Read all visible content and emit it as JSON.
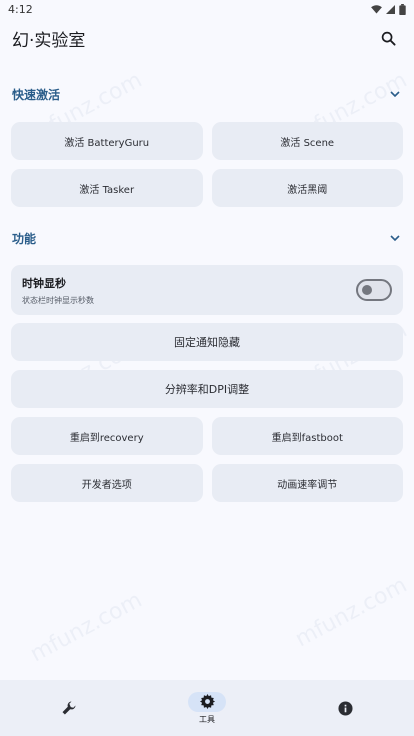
{
  "status_bar": {
    "time": "4:12"
  },
  "app_bar": {
    "title": "幻·实验室"
  },
  "quick_activate": {
    "title": "快速激活",
    "buttons": [
      "激活 BatteryGuru",
      "激活 Scene",
      "激活 Tasker",
      "激活黑阈"
    ]
  },
  "features": {
    "title": "功能",
    "clock_toggle": {
      "title": "时钟显秒",
      "subtitle": "状态栏时钟显示秒数",
      "enabled": false
    },
    "hide_notification": "固定通知隐藏",
    "resolution_dpi": "分辨率和DPI调整",
    "grid_buttons": [
      "重启到recovery",
      "重启到fastboot",
      "开发者选项",
      "动画速率调节"
    ]
  },
  "bottom_nav": {
    "items": [
      {
        "icon": "wrench-icon",
        "label": ""
      },
      {
        "icon": "gear-icon",
        "label": "工具",
        "active": true
      },
      {
        "icon": "info-icon",
        "label": ""
      }
    ]
  },
  "watermark": "mfunz.com",
  "colors": {
    "accent": "#2a5d8a",
    "card": "#e8ecf4",
    "background": "#f8f9fe"
  }
}
